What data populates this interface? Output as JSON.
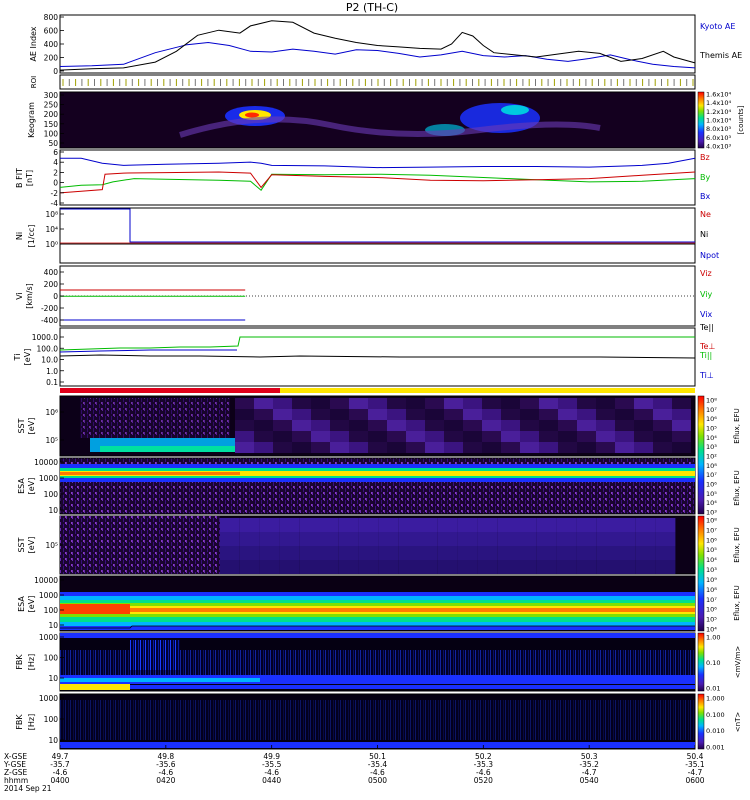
{
  "title": "P2 (TH-C)",
  "chart_data": {
    "type": "line",
    "panels": [
      {
        "id": "ae",
        "ylabel": "AE Index",
        "yticks": [
          "800",
          "600",
          "400",
          "200",
          "0"
        ],
        "ylim": [
          0,
          800
        ],
        "legend": [
          "Kyoto AE",
          "Themis AE"
        ],
        "legend_colors": [
          "#0000cc",
          "#000000"
        ],
        "series": [
          {
            "name": "Kyoto AE",
            "color": "#0000cc",
            "x": [
              0,
              6,
              12,
              18,
              24,
              28,
              32,
              36,
              40,
              44,
              48,
              52,
              56,
              60,
              64,
              68,
              72,
              76,
              80,
              84,
              88,
              92,
              96,
              100,
              104,
              108,
              112,
              116,
              120
            ],
            "y": [
              90,
              100,
              120,
              280,
              390,
              420,
              380,
              300,
              290,
              330,
              300,
              260,
              320,
              310,
              270,
              220,
              250,
              300,
              240,
              220,
              240,
              190,
              160,
              200,
              250,
              180,
              120,
              90,
              70
            ]
          },
          {
            "name": "Themis AE",
            "color": "#000000",
            "x": [
              0,
              6,
              12,
              18,
              22,
              26,
              30,
              34,
              36,
              40,
              44,
              48,
              52,
              56,
              60,
              64,
              68,
              72,
              74,
              76,
              78,
              80,
              82,
              86,
              90,
              94,
              98,
              102,
              106,
              110,
              114,
              116,
              120
            ],
            "y": [
              40,
              60,
              70,
              150,
              300,
              520,
              590,
              550,
              650,
              720,
              700,
              550,
              480,
              420,
              380,
              360,
              340,
              330,
              400,
              560,
              510,
              380,
              280,
              250,
              220,
              260,
              300,
              270,
              160,
              200,
              300,
              220,
              140
            ]
          }
        ]
      },
      {
        "id": "roi",
        "ylabel": "ROI"
      },
      {
        "id": "keogram",
        "ylabel": "Keogram",
        "yticks": [
          "300",
          "250",
          "200",
          "150",
          "100",
          "50"
        ],
        "colorbar_label": "[counts]",
        "colorbar_ticks": [
          "1.6x10⁴",
          "1.4x10⁴",
          "1.2x10⁴",
          "1.0x10⁴",
          "8.0x10³",
          "6.0x10³",
          "4.0x10³"
        ]
      },
      {
        "id": "bfield",
        "ylabel": "B FIT",
        "unit": "[nT]",
        "yticks": [
          "6",
          "4",
          "2",
          "0",
          "-2",
          "-4"
        ],
        "ylim": [
          -4,
          6
        ],
        "legend": [
          "Bz",
          "By",
          "Bx"
        ],
        "legend_colors": [
          "#cc0000",
          "#00bb00",
          "#0000cc"
        ],
        "series": [
          {
            "name": "Bz",
            "color": "#0000cc",
            "x": [
              0,
              4,
              8,
              12,
              20,
              30,
              36,
              38,
              40,
              50,
              60,
              70,
              80,
              90,
              100,
              110,
              115,
              120
            ],
            "y": [
              4.5,
              4.5,
              3.6,
              3.2,
              3.4,
              3.6,
              3.8,
              3.6,
              3.2,
              3.1,
              2.8,
              2.9,
              3.0,
              3.0,
              2.9,
              3.2,
              3.6,
              4.5
            ]
          },
          {
            "name": "By",
            "color": "#00bb00",
            "x": [
              0,
              4,
              8,
              10,
              14,
              20,
              30,
              36,
              38,
              40,
              50,
              60,
              70,
              80,
              90,
              100,
              110,
              120
            ],
            "y": [
              -0.8,
              -0.4,
              -0.3,
              0.2,
              0.8,
              0.7,
              0.5,
              0.3,
              -1.3,
              1.6,
              1.5,
              1.6,
              1.4,
              1.0,
              0.6,
              0.2,
              0.3,
              0.8
            ]
          },
          {
            "name": "Bx",
            "color": "#cc0000",
            "x": [
              0,
              4,
              8,
              8.5,
              12,
              20,
              30,
              36,
              38,
              40,
              50,
              60,
              70,
              80,
              90,
              100,
              110,
              120
            ],
            "y": [
              -1.8,
              -1.5,
              -1.2,
              1.6,
              1.8,
              1.9,
              2.0,
              1.8,
              -0.8,
              1.5,
              1.2,
              1.0,
              0.5,
              0.4,
              0.6,
              0.8,
              1.4,
              2.0
            ]
          }
        ]
      },
      {
        "id": "density",
        "ylabel": "Ni",
        "unit": "[1/cc]",
        "yticks": [
          "10⁸",
          "10⁴",
          "10⁰"
        ],
        "legend": [
          "Ne",
          "Ni",
          "Npot"
        ],
        "legend_colors": [
          "#cc0000",
          "#000000",
          "#0000cc"
        ]
      },
      {
        "id": "velocity",
        "ylabel": "Vi",
        "unit": "[km/s]",
        "yticks": [
          "400",
          "200",
          "0",
          "-200",
          "-400"
        ],
        "ylim": [
          -500,
          500
        ],
        "legend": [
          "Viz",
          "Viy",
          "Vix"
        ],
        "legend_colors": [
          "#cc0000",
          "#00bb00",
          "#0000cc"
        ],
        "series": [
          {
            "name": "Viz",
            "color": "#cc0000",
            "x": [
              0,
              35
            ],
            "y": [
              100,
              100
            ]
          },
          {
            "name": "Viy",
            "color": "#00bb00",
            "x": [
              0,
              35
            ],
            "y": [
              -5,
              -5
            ]
          },
          {
            "name": "Vix",
            "color": "#0000cc",
            "x": [
              0,
              35
            ],
            "y": [
              -400,
              -400
            ]
          }
        ]
      },
      {
        "id": "temperature",
        "ylabel": "Ti",
        "unit": "[eV]",
        "yticks": [
          "1000.0",
          "100.0",
          "10.0",
          "1.0",
          "0.1"
        ],
        "legend": [
          "Te||",
          "Te⊥",
          "Ti||",
          "Ti⊥"
        ],
        "legend_colors": [
          "#000000",
          "#cc0000",
          "#00bb00",
          "#0000cc"
        ]
      },
      {
        "id": "sst_ion",
        "ylabel": "SST",
        "unit": "[eV]",
        "yticks": [
          "10⁶",
          "10⁵"
        ],
        "colorbar_label": "Eflux, EFU",
        "colorbar_ticks": [
          "10⁸",
          "10⁷",
          "10⁶",
          "10⁵",
          "10⁴",
          "10³",
          "10²"
        ]
      },
      {
        "id": "esa_ion",
        "ylabel": "ESA",
        "unit": "[eV]",
        "yticks": [
          "10000",
          "1000",
          "100",
          "10"
        ],
        "colorbar_label": "Eflux, EFU",
        "colorbar_ticks": [
          "10⁸",
          "10⁷",
          "10⁶",
          "10⁵",
          "10⁴",
          "10³"
        ]
      },
      {
        "id": "sst_elec",
        "ylabel": "SST",
        "unit": "[eV]",
        "yticks": [
          "10⁵"
        ],
        "colorbar_label": "Eflux, EFU",
        "colorbar_ticks": [
          "10⁸",
          "10⁷",
          "10⁶",
          "10⁵",
          "10⁴",
          "10³"
        ]
      },
      {
        "id": "esa_elec",
        "ylabel": "ESA",
        "unit": "[eV]",
        "yticks": [
          "10000",
          "1000",
          "100",
          "10"
        ],
        "colorbar_label": "Eflux, EFU",
        "colorbar_ticks": [
          "10⁹",
          "10⁸",
          "10⁷",
          "10⁶",
          "10⁵",
          "10⁴"
        ]
      },
      {
        "id": "fbk_e",
        "ylabel": "FBK",
        "unit": "[Hz]",
        "yticks": [
          "1000",
          "100",
          "10"
        ],
        "colorbar_label": "<mV/m>",
        "colorbar_ticks": [
          "1.00",
          "0.10",
          "0.01"
        ]
      },
      {
        "id": "fbk_b",
        "ylabel": "FBK",
        "unit": "[Hz]",
        "yticks": [
          "1000",
          "100",
          "10"
        ],
        "colorbar_label": "<nT>",
        "colorbar_ticks": [
          "1.000",
          "0.100",
          "0.010",
          "0.001"
        ]
      }
    ],
    "x_axis": {
      "row_labels": [
        "X-GSE",
        "Y-GSE",
        "Z-GSE",
        "hhmm",
        "2014 Sep 21"
      ],
      "ticks": [
        {
          "x": 0,
          "values": [
            "49.7",
            "-35.7",
            "-4.6",
            "0400"
          ]
        },
        {
          "x": 20,
          "values": [
            "49.8",
            "-35.6",
            "-4.6",
            "0420"
          ]
        },
        {
          "x": 40,
          "values": [
            "49.9",
            "-35.5",
            "-4.6",
            "0440"
          ]
        },
        {
          "x": 60,
          "values": [
            "50.1",
            "-35.4",
            "-4.6",
            "0500"
          ]
        },
        {
          "x": 80,
          "values": [
            "50.2",
            "-35.3",
            "-4.6",
            "0520"
          ]
        },
        {
          "x": 100,
          "values": [
            "50.3",
            "-35.2",
            "-4.7",
            "0540"
          ]
        },
        {
          "x": 120,
          "values": [
            "50.4",
            "-35.1",
            "-4.7",
            "0600"
          ]
        }
      ]
    }
  }
}
